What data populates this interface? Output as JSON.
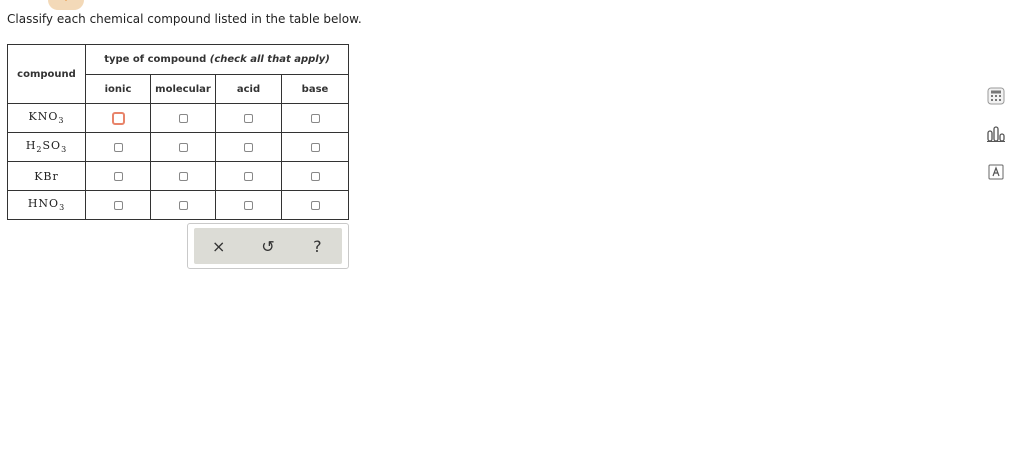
{
  "prompt": "Classify each chemical compound listed in the table below.",
  "table": {
    "compound_header": "compound",
    "type_header": "type of compound",
    "type_hint": "(check all that apply)",
    "columns": [
      "ionic",
      "molecular",
      "acid",
      "base"
    ],
    "rows": [
      {
        "formula_main": "KNO",
        "formula_sub": "3",
        "formula_rest": "",
        "formula_sub2": ""
      },
      {
        "formula_main": "H",
        "formula_sub": "2",
        "formula_rest": "SO",
        "formula_sub2": "3"
      },
      {
        "formula_main": "KBr",
        "formula_sub": "",
        "formula_rest": "",
        "formula_sub2": ""
      },
      {
        "formula_main": "HNO",
        "formula_sub": "3",
        "formula_rest": "",
        "formula_sub2": ""
      }
    ]
  },
  "actions": {
    "clear": "×",
    "undo": "↺",
    "help": "?"
  },
  "tools": [
    "calculator-icon",
    "bar-chart-icon",
    "periodic-table-icon"
  ],
  "colors": {
    "focus": "#e8846a",
    "tab": "#f3d9b8",
    "tab_arrow": "#e8913a",
    "action_bg": "#dcdcd6"
  }
}
